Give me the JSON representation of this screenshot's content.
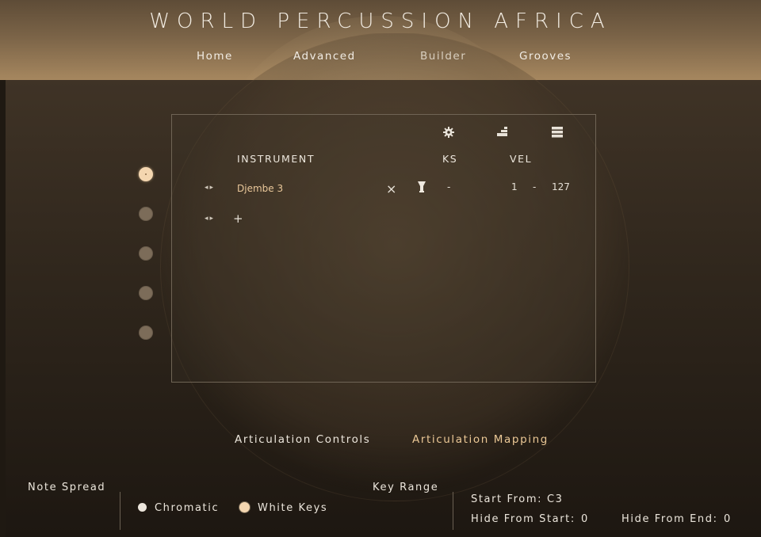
{
  "app": {
    "title": "WORLD PERCUSSION AFRICA",
    "nav": [
      "Home",
      "Advanced",
      "Builder",
      "Grooves"
    ],
    "active_nav": "Builder"
  },
  "panel": {
    "headers": {
      "instrument": "INSTRUMENT",
      "ks": "KS",
      "vel": "VEL"
    },
    "toolbar_icons": [
      "gear-icon",
      "steps-icon",
      "list-icon"
    ],
    "rows": [
      {
        "name": "Djembe 3",
        "remove": "×",
        "ks": "-",
        "vel_low": "1",
        "vel_sep": "-",
        "vel_high": "127"
      }
    ],
    "arrows": "◂▸",
    "add_label": "+"
  },
  "slots": {
    "count": 5,
    "active_index": 0
  },
  "tabs": {
    "controls": "Articulation Controls",
    "mapping": "Articulation Mapping",
    "active": "mapping"
  },
  "bottom": {
    "note_spread": {
      "label": "Note Spread",
      "options": [
        "Chromatic",
        "White Keys"
      ],
      "selected": "White Keys"
    },
    "key_range": {
      "label": "Key Range",
      "start_from_label": "Start From:",
      "start_from_value": "C3",
      "hide_start_label": "Hide From Start:",
      "hide_start_value": "0",
      "hide_end_label": "Hide From End:",
      "hide_end_value": "0"
    }
  },
  "colors": {
    "accent": "#e9c79a",
    "active_dot": "#f4d6b0",
    "inactive_dot": "#7c6c59"
  }
}
